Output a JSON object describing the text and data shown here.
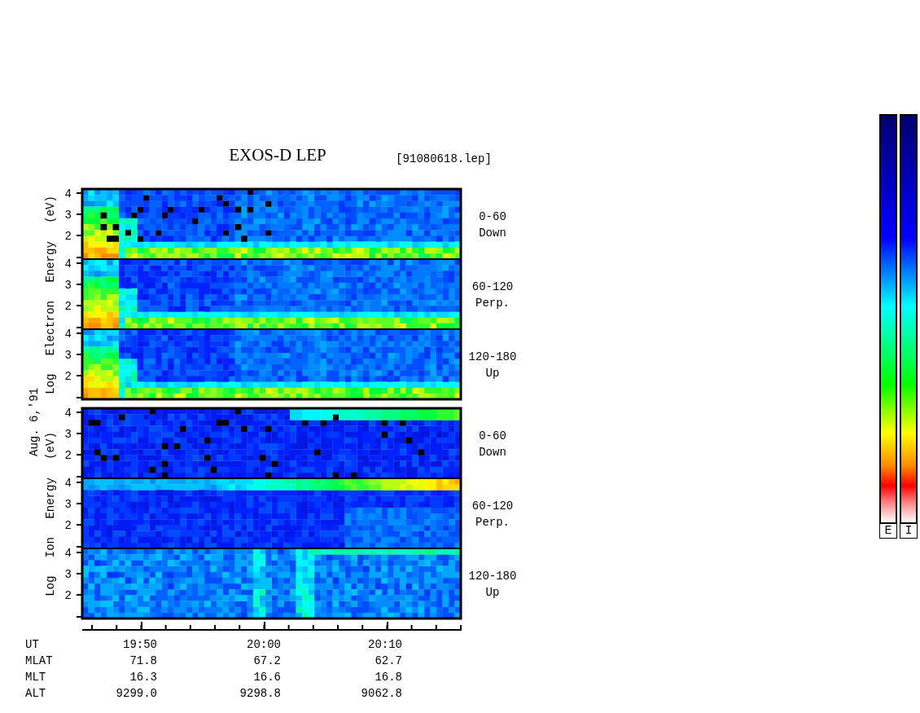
{
  "title": "EXOS-D LEP",
  "file_name": "[91080618.lep]",
  "date": "Aug. 6,'91",
  "groups": [
    {
      "kind": "electron",
      "label": "Log Electron Energy (eV)",
      "panels": [
        {
          "ticks": [
            "4",
            "3",
            "2"
          ],
          "angle": "0-60",
          "direction": "Down"
        },
        {
          "ticks": [
            "4",
            "3",
            "2"
          ],
          "angle": "60-120",
          "direction": "Perp."
        },
        {
          "ticks": [
            "4",
            "3",
            "2"
          ],
          "angle": "120-180",
          "direction": "Up"
        }
      ]
    },
    {
      "kind": "ion",
      "label": "Log Ion Energy (eV)",
      "panels": [
        {
          "ticks": [
            "4",
            "3",
            "2"
          ],
          "angle": "0-60",
          "direction": "Down"
        },
        {
          "ticks": [
            "4",
            "3",
            "2"
          ],
          "angle": "60-120",
          "direction": "Perp."
        },
        {
          "ticks": [
            "4",
            "3",
            "2"
          ],
          "angle": "120-180",
          "direction": "Up"
        }
      ]
    }
  ],
  "time_rows": [
    {
      "label": "UT",
      "values": [
        "19:50",
        "20:00",
        "20:10"
      ]
    },
    {
      "label": "MLAT",
      "values": [
        "71.8",
        "67.2",
        "62.7"
      ]
    },
    {
      "label": "MLT",
      "values": [
        "16.3",
        "16.6",
        "16.8"
      ]
    },
    {
      "label": "ALT",
      "values": [
        "9299.0",
        "9298.8",
        "9062.8"
      ]
    }
  ],
  "colorbars": [
    {
      "label": "E"
    },
    {
      "label": "I"
    }
  ]
}
